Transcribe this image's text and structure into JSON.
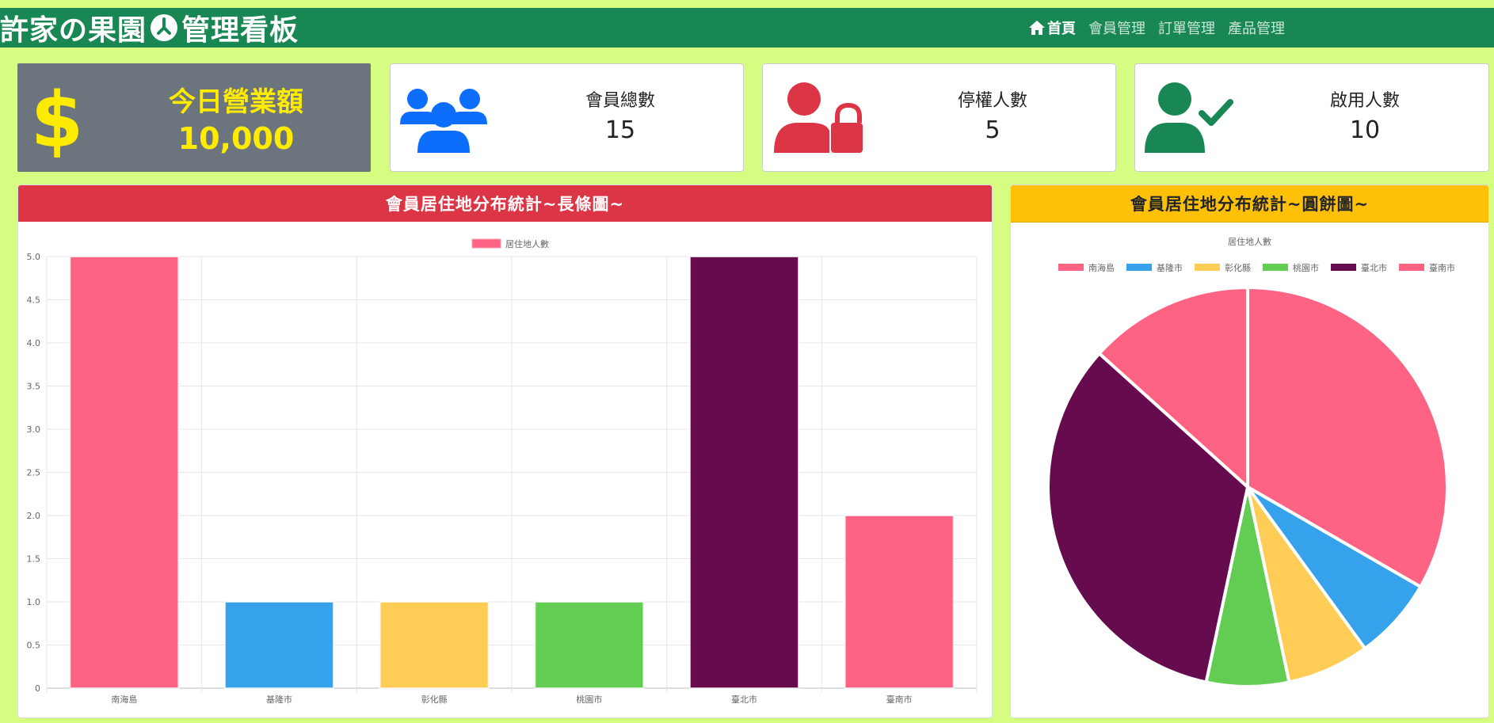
{
  "navbar": {
    "brand_part1": "許家の果園",
    "brand_part2": "管理看板",
    "links": [
      {
        "label": "首頁",
        "active": true
      },
      {
        "label": "會員管理",
        "active": false
      },
      {
        "label": "訂單管理",
        "active": false
      },
      {
        "label": "產品管理",
        "active": false
      }
    ]
  },
  "cards": {
    "revenue": {
      "title": "今日營業額",
      "value": "10,000",
      "icon": "dollar-icon"
    },
    "members_total": {
      "title": "會員總數",
      "value": "15",
      "icon": "users-icon"
    },
    "suspended": {
      "title": "停權人數",
      "value": "5",
      "icon": "user-lock-icon"
    },
    "enabled": {
      "title": "啟用人數",
      "value": "10",
      "icon": "user-check-icon"
    }
  },
  "bar_panel": {
    "title": "會員居住地分布統計~長條圖~"
  },
  "pie_panel": {
    "title": "會員居住地分布統計~圓餅圖~"
  },
  "colors": {
    "navbar": "#198754",
    "page_bg": "#d6fd82",
    "revenue_card": "#6c757d",
    "revenue_text": "#ffeb00",
    "bar_header": "#dc3545",
    "pie_header": "#ffc107",
    "icon_blue": "#0d6efd",
    "icon_red": "#dc3545",
    "icon_green": "#198754"
  },
  "chart_data": [
    {
      "type": "bar",
      "title": "",
      "legend": [
        "居住地人數"
      ],
      "legend_position": "top",
      "categories": [
        "南海島",
        "基隆市",
        "彰化縣",
        "桃園市",
        "臺北市",
        "臺南市"
      ],
      "series": [
        {
          "name": "居住地人數",
          "values": [
            5,
            1,
            1,
            1,
            5,
            2
          ]
        }
      ],
      "colors": [
        "#ff6384",
        "#36a2eb",
        "#ffcd56",
        "#63cc52",
        "#650b4e",
        "#ff6384"
      ],
      "ylim": [
        0,
        5
      ],
      "yticks": [
        "0",
        "0.5",
        "1.0",
        "1.5",
        "2.0",
        "2.5",
        "3.0",
        "3.5",
        "4.0",
        "4.5",
        "5.0"
      ],
      "grid": true
    },
    {
      "type": "pie",
      "title": "居住地人數",
      "legend_position": "top",
      "categories": [
        "南海島",
        "基隆市",
        "彰化縣",
        "桃園市",
        "臺北市",
        "臺南市"
      ],
      "values": [
        5,
        1,
        1,
        1,
        5,
        2
      ],
      "colors": [
        "#ff6384",
        "#36a2eb",
        "#ffcd56",
        "#63cc52",
        "#650b4e",
        "#ff6384"
      ]
    }
  ]
}
